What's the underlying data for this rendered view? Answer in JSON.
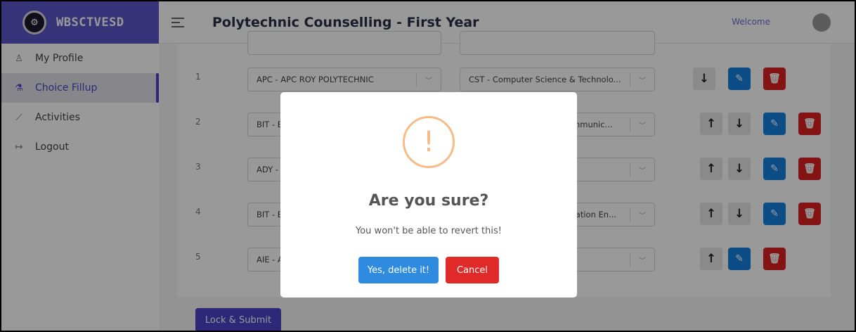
{
  "app": {
    "logo_text": "WBSCTVESD",
    "page_title": "Polytechnic Counselling - First Year",
    "welcome": "Welcome"
  },
  "sidebar": {
    "items": [
      {
        "label": "My Profile",
        "icon": "user-icon"
      },
      {
        "label": "Choice Fillup",
        "icon": "flask-icon",
        "active": true
      },
      {
        "label": "Activities",
        "icon": "chart-line-icon"
      },
      {
        "label": "Logout",
        "icon": "logout-icon"
      }
    ]
  },
  "choices": [
    {
      "num": "1",
      "institute": "APC - APC ROY POLYTECHNIC",
      "course": "CST - Computer Science & Technolo..."
    },
    {
      "num": "2",
      "institute": "BIT - B",
      "course": "ommunic..."
    },
    {
      "num": "3",
      "institute": "ADY -",
      "course": ""
    },
    {
      "num": "4",
      "institute": "BIT - B",
      "course": "ntation En..."
    },
    {
      "num": "5",
      "institute": "AIE - A",
      "course": ""
    }
  ],
  "actions": {
    "up_icon": "↑",
    "down_icon": "↓",
    "lock_submit": "Lock & Submit"
  },
  "modal": {
    "icon": "!",
    "title": "Are you sure?",
    "text": "You won't be able to revert this!",
    "confirm": "Yes, delete it!",
    "cancel": "Cancel"
  },
  "colors": {
    "brand": "#5a55c9",
    "accent": "#4b44c7",
    "edit": "#1580e0",
    "delete": "#dd2020",
    "warning": "#f8bb86"
  }
}
